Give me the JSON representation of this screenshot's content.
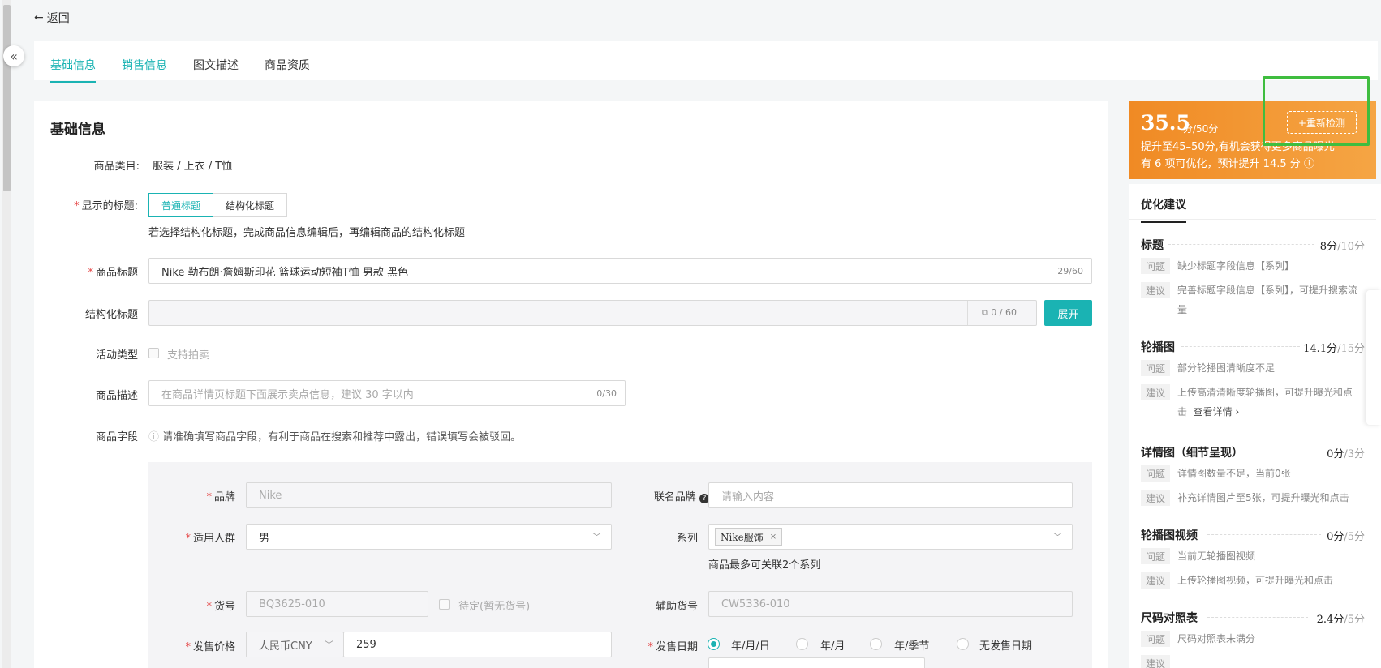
{
  "nav": {
    "back_label": "返回",
    "collapse_icon": "«"
  },
  "tabs": [
    {
      "label": "基础信息"
    },
    {
      "label": "销售信息"
    },
    {
      "label": "图文描述"
    },
    {
      "label": "商品资质"
    }
  ],
  "form": {
    "section_title": "基础信息",
    "category": {
      "label": "商品类目:",
      "value": "服装 / 上衣 / T恤"
    },
    "title_mode": {
      "label": "显示的标题:",
      "options": [
        "普通标题",
        "结构化标题"
      ],
      "selected": "普通标题",
      "hint": "若选择结构化标题，完成商品信息编辑后，再编辑商品的结构化标题"
    },
    "product_title": {
      "label": "商品标题",
      "value": "Nike 勒布朗·詹姆斯印花 篮球运动短袖T恤 男款 黑色",
      "counter": "29/60"
    },
    "structured_title": {
      "label": "结构化标题",
      "counter": "0 / 60",
      "expand_label": "展开"
    },
    "activity": {
      "label": "活动类型",
      "option": "支持拍卖"
    },
    "description": {
      "label": "商品描述",
      "placeholder": "在商品详情页标题下面展示卖点信息，建议 30 字以内",
      "counter": "0/30"
    },
    "fields": {
      "label": "商品字段",
      "notice": "请准确填写商品字段，有利于商品在搜索和推荐中露出，错误填写会被驳回。"
    },
    "brand": {
      "label": "品牌",
      "value": "Nike"
    },
    "co_brand": {
      "label": "联名品牌",
      "placeholder": "请输入内容"
    },
    "audience": {
      "label": "适用人群",
      "value": "男"
    },
    "series": {
      "label": "系列",
      "tag": "Nike服饰",
      "hint": "商品最多可关联2个系列"
    },
    "sku": {
      "label": "货号",
      "value": "BQ3625-010",
      "pending_label": "待定(暂无货号)"
    },
    "aux_sku": {
      "label": "辅助货号",
      "value": "CW5336-010"
    },
    "price": {
      "label": "发售价格",
      "currency": "人民币CNY",
      "value": "259"
    },
    "release_date": {
      "label": "发售日期",
      "options": [
        "年/月/日",
        "年/月",
        "年/季节",
        "无发售日期"
      ],
      "selected": "年/月/日"
    }
  },
  "score": {
    "value": "35.5",
    "unit": "分/50分",
    "recheck_label": "+重新检测",
    "line1": "提升至45–50分,有机会获得更多商品曝光",
    "line2": "有 6 项可优化，预计提升 14.5 分"
  },
  "suggestions": {
    "tab_label": "优化建议",
    "issue_badge": "问题",
    "advice_badge": "建议",
    "items": [
      {
        "title": "标题",
        "score": "8分",
        "max": "/10分",
        "issue": "缺少标题字段信息【系列】",
        "advice": "完善标题字段信息【系列】，可提升搜索流量"
      },
      {
        "title": "轮播图",
        "score": "14.1分",
        "max": "/15分",
        "issue": "部分轮播图清晰度不足",
        "advice": "上传高清清晰度轮播图，可提升曝光和点击",
        "link": "查看详情"
      },
      {
        "title": "详情图（细节呈现）",
        "score": "0分",
        "max": "/3分",
        "issue": "详情图数量不足，当前0张",
        "advice": "补充详情图片至5张，可提升曝光和点击"
      },
      {
        "title": "轮播图视频",
        "score": "0分",
        "max": "/5分",
        "issue": "当前无轮播图视频",
        "advice": "上传轮播图视频，可提升曝光和点击"
      },
      {
        "title": "尺码对照表",
        "score": "2.4分",
        "max": "/5分",
        "issue": "尺码对照表未满分"
      }
    ]
  },
  "colors": {
    "accent": "#1ab3b3",
    "score_bg": "#f08a24",
    "highlight": "#3fbd3f",
    "required": "#e54545"
  }
}
